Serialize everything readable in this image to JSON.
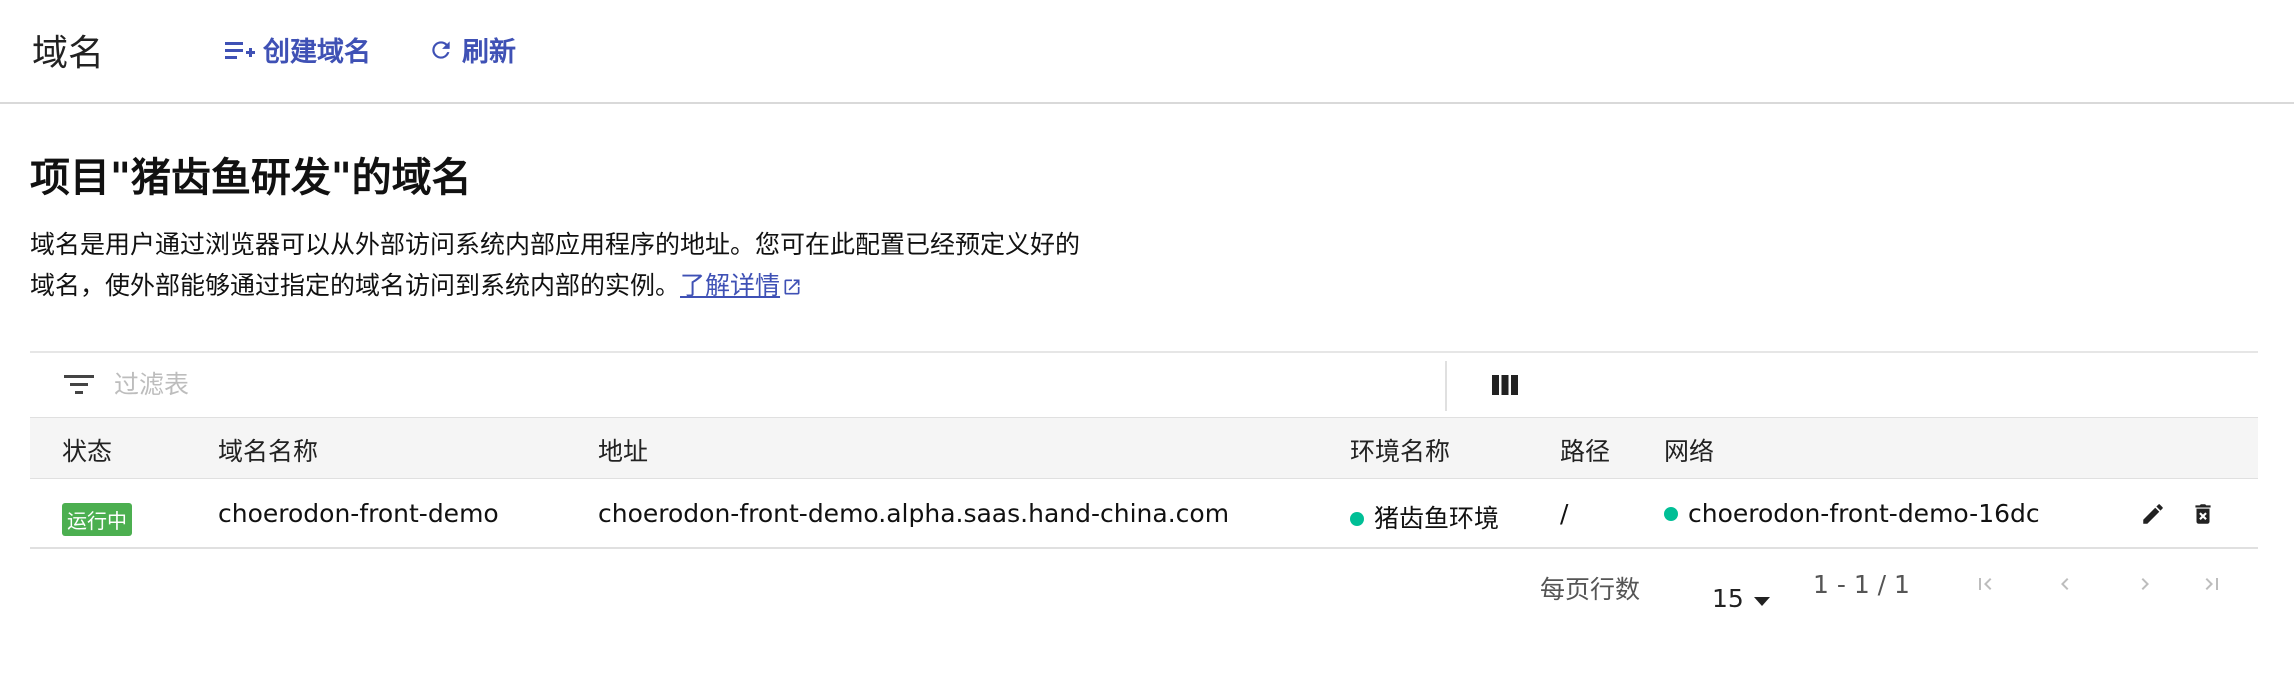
{
  "header": {
    "title": "域名",
    "create_label": "创建域名",
    "refresh_label": "刷新"
  },
  "page": {
    "heading": "项目\"猪齿鱼研发\"的域名",
    "description": "域名是用户通过浏览器可以从外部访问系统内部应用程序的地址。您可在此配置已经预定义好的域名，使外部能够通过指定的域名访问到系统内部的实例。",
    "learn_more": "了解详情"
  },
  "filter": {
    "placeholder": "过滤表"
  },
  "table": {
    "columns": [
      "状态",
      "域名名称",
      "地址",
      "环境名称",
      "路径",
      "网络"
    ],
    "rows": [
      {
        "status": "运行中",
        "name": "choerodon-front-demo",
        "address": "choerodon-front-demo.alpha.saas.hand-china.com",
        "env": "猪齿鱼环境",
        "path": "/",
        "network": "choerodon-front-demo-16dc"
      }
    ]
  },
  "pagination": {
    "rows_per_page_label": "每页行数",
    "rows_per_page": "15",
    "range": "1 - 1 / 1"
  },
  "colors": {
    "accent": "#3f51b5",
    "status_running": "#4caf50",
    "status_dot": "#00bf96"
  }
}
